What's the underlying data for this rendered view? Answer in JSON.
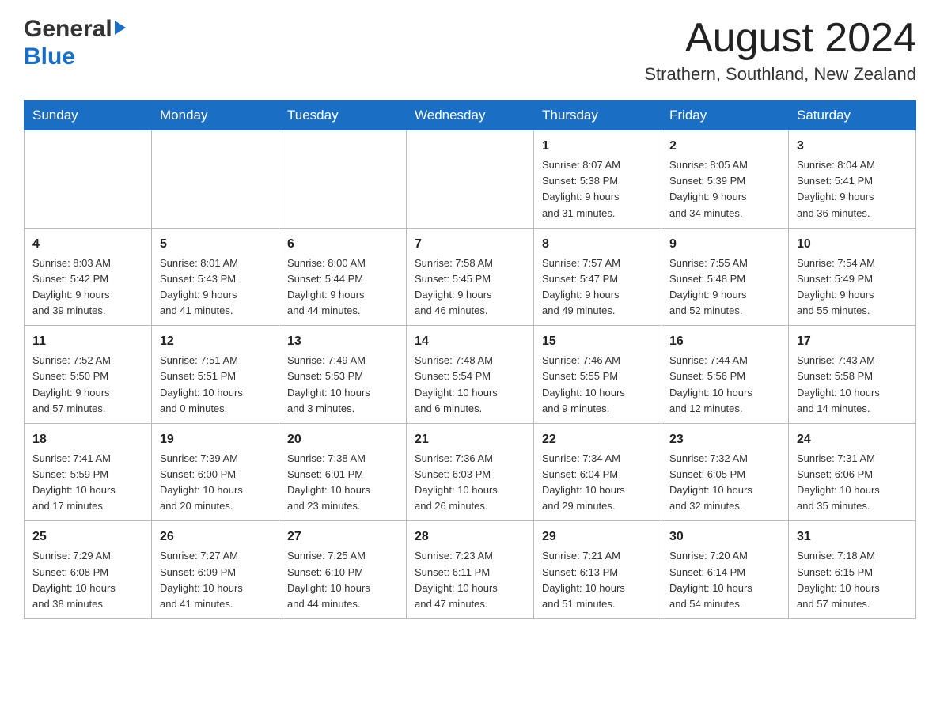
{
  "header": {
    "logo_general": "General",
    "logo_blue": "Blue",
    "month_title": "August 2024",
    "location": "Strathern, Southland, New Zealand"
  },
  "days_of_week": [
    "Sunday",
    "Monday",
    "Tuesday",
    "Wednesday",
    "Thursday",
    "Friday",
    "Saturday"
  ],
  "weeks": [
    {
      "days": [
        {
          "num": "",
          "info": ""
        },
        {
          "num": "",
          "info": ""
        },
        {
          "num": "",
          "info": ""
        },
        {
          "num": "",
          "info": ""
        },
        {
          "num": "1",
          "info": "Sunrise: 8:07 AM\nSunset: 5:38 PM\nDaylight: 9 hours\nand 31 minutes."
        },
        {
          "num": "2",
          "info": "Sunrise: 8:05 AM\nSunset: 5:39 PM\nDaylight: 9 hours\nand 34 minutes."
        },
        {
          "num": "3",
          "info": "Sunrise: 8:04 AM\nSunset: 5:41 PM\nDaylight: 9 hours\nand 36 minutes."
        }
      ]
    },
    {
      "days": [
        {
          "num": "4",
          "info": "Sunrise: 8:03 AM\nSunset: 5:42 PM\nDaylight: 9 hours\nand 39 minutes."
        },
        {
          "num": "5",
          "info": "Sunrise: 8:01 AM\nSunset: 5:43 PM\nDaylight: 9 hours\nand 41 minutes."
        },
        {
          "num": "6",
          "info": "Sunrise: 8:00 AM\nSunset: 5:44 PM\nDaylight: 9 hours\nand 44 minutes."
        },
        {
          "num": "7",
          "info": "Sunrise: 7:58 AM\nSunset: 5:45 PM\nDaylight: 9 hours\nand 46 minutes."
        },
        {
          "num": "8",
          "info": "Sunrise: 7:57 AM\nSunset: 5:47 PM\nDaylight: 9 hours\nand 49 minutes."
        },
        {
          "num": "9",
          "info": "Sunrise: 7:55 AM\nSunset: 5:48 PM\nDaylight: 9 hours\nand 52 minutes."
        },
        {
          "num": "10",
          "info": "Sunrise: 7:54 AM\nSunset: 5:49 PM\nDaylight: 9 hours\nand 55 minutes."
        }
      ]
    },
    {
      "days": [
        {
          "num": "11",
          "info": "Sunrise: 7:52 AM\nSunset: 5:50 PM\nDaylight: 9 hours\nand 57 minutes."
        },
        {
          "num": "12",
          "info": "Sunrise: 7:51 AM\nSunset: 5:51 PM\nDaylight: 10 hours\nand 0 minutes."
        },
        {
          "num": "13",
          "info": "Sunrise: 7:49 AM\nSunset: 5:53 PM\nDaylight: 10 hours\nand 3 minutes."
        },
        {
          "num": "14",
          "info": "Sunrise: 7:48 AM\nSunset: 5:54 PM\nDaylight: 10 hours\nand 6 minutes."
        },
        {
          "num": "15",
          "info": "Sunrise: 7:46 AM\nSunset: 5:55 PM\nDaylight: 10 hours\nand 9 minutes."
        },
        {
          "num": "16",
          "info": "Sunrise: 7:44 AM\nSunset: 5:56 PM\nDaylight: 10 hours\nand 12 minutes."
        },
        {
          "num": "17",
          "info": "Sunrise: 7:43 AM\nSunset: 5:58 PM\nDaylight: 10 hours\nand 14 minutes."
        }
      ]
    },
    {
      "days": [
        {
          "num": "18",
          "info": "Sunrise: 7:41 AM\nSunset: 5:59 PM\nDaylight: 10 hours\nand 17 minutes."
        },
        {
          "num": "19",
          "info": "Sunrise: 7:39 AM\nSunset: 6:00 PM\nDaylight: 10 hours\nand 20 minutes."
        },
        {
          "num": "20",
          "info": "Sunrise: 7:38 AM\nSunset: 6:01 PM\nDaylight: 10 hours\nand 23 minutes."
        },
        {
          "num": "21",
          "info": "Sunrise: 7:36 AM\nSunset: 6:03 PM\nDaylight: 10 hours\nand 26 minutes."
        },
        {
          "num": "22",
          "info": "Sunrise: 7:34 AM\nSunset: 6:04 PM\nDaylight: 10 hours\nand 29 minutes."
        },
        {
          "num": "23",
          "info": "Sunrise: 7:32 AM\nSunset: 6:05 PM\nDaylight: 10 hours\nand 32 minutes."
        },
        {
          "num": "24",
          "info": "Sunrise: 7:31 AM\nSunset: 6:06 PM\nDaylight: 10 hours\nand 35 minutes."
        }
      ]
    },
    {
      "days": [
        {
          "num": "25",
          "info": "Sunrise: 7:29 AM\nSunset: 6:08 PM\nDaylight: 10 hours\nand 38 minutes."
        },
        {
          "num": "26",
          "info": "Sunrise: 7:27 AM\nSunset: 6:09 PM\nDaylight: 10 hours\nand 41 minutes."
        },
        {
          "num": "27",
          "info": "Sunrise: 7:25 AM\nSunset: 6:10 PM\nDaylight: 10 hours\nand 44 minutes."
        },
        {
          "num": "28",
          "info": "Sunrise: 7:23 AM\nSunset: 6:11 PM\nDaylight: 10 hours\nand 47 minutes."
        },
        {
          "num": "29",
          "info": "Sunrise: 7:21 AM\nSunset: 6:13 PM\nDaylight: 10 hours\nand 51 minutes."
        },
        {
          "num": "30",
          "info": "Sunrise: 7:20 AM\nSunset: 6:14 PM\nDaylight: 10 hours\nand 54 minutes."
        },
        {
          "num": "31",
          "info": "Sunrise: 7:18 AM\nSunset: 6:15 PM\nDaylight: 10 hours\nand 57 minutes."
        }
      ]
    }
  ]
}
